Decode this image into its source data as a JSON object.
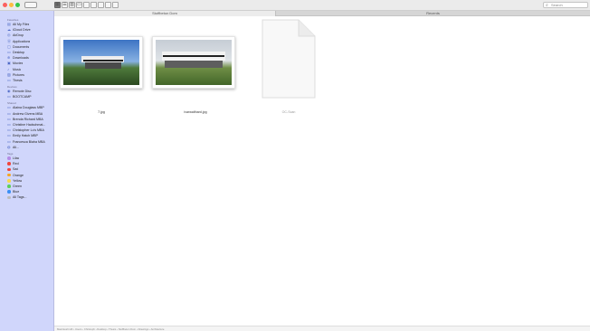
{
  "toolbar": {
    "search_placeholder": "Search",
    "search_glyph": "⌕",
    "view_buttons": [
      "▦",
      "☰",
      "▥",
      "▭"
    ]
  },
  "tabs": [
    {
      "label": "Stoffbeton Dom",
      "active": true
    },
    {
      "label": "Recents",
      "active": false
    }
  ],
  "sidebar": {
    "sections": [
      {
        "heading": "Favorites",
        "items": [
          {
            "label": "All My Files",
            "icon": "all-files-icon",
            "glyph": "▤"
          },
          {
            "label": "iCloud Drive",
            "icon": "cloud-icon",
            "glyph": "☁"
          },
          {
            "label": "AirDrop",
            "icon": "airdrop-icon",
            "glyph": "◎"
          },
          {
            "label": "Applications",
            "icon": "applications-icon",
            "glyph": "Ⓐ"
          },
          {
            "label": "Documents",
            "icon": "documents-icon",
            "glyph": "▢"
          },
          {
            "label": "Desktop",
            "icon": "desktop-icon",
            "glyph": "▭"
          },
          {
            "label": "Downloads",
            "icon": "downloads-icon",
            "glyph": "⊕"
          },
          {
            "label": "Movies",
            "icon": "movies-icon",
            "glyph": "▣"
          },
          {
            "label": "Music",
            "icon": "music-icon",
            "glyph": "♪"
          },
          {
            "label": "Pictures",
            "icon": "pictures-icon",
            "glyph": "▨"
          },
          {
            "label": "Thesis",
            "icon": "folder-icon",
            "glyph": "▭"
          }
        ]
      },
      {
        "heading": "Devices",
        "items": [
          {
            "label": "Remote Disc",
            "icon": "remote-disc-icon",
            "glyph": "◉"
          },
          {
            "label": "BOOTCAMP",
            "icon": "drive-icon",
            "glyph": "▭"
          }
        ]
      },
      {
        "heading": "Shared",
        "items": [
          {
            "label": "Alaina Douglass MBP",
            "icon": "computer-icon",
            "glyph": "▭"
          },
          {
            "label": "Andrew Givens MBA",
            "icon": "computer-icon",
            "glyph": "▭"
          },
          {
            "label": "Brenda Richard MBA",
            "icon": "computer-icon",
            "glyph": "▭"
          },
          {
            "label": "Christine Hadschmat...",
            "icon": "computer-icon",
            "glyph": "▭"
          },
          {
            "label": "Christopher Lo's MBA",
            "icon": "computer-icon",
            "glyph": "▭"
          },
          {
            "label": "Emily Hatch MBP",
            "icon": "computer-icon",
            "glyph": "▭"
          },
          {
            "label": "Francesca Blaha MBA",
            "icon": "computer-icon",
            "glyph": "▭"
          },
          {
            "label": "All...",
            "icon": "network-icon",
            "glyph": "◍"
          }
        ]
      },
      {
        "heading": "Tags",
        "items": [
          {
            "label": "Lilac",
            "tag_color": "#b48be6"
          },
          {
            "label": "Red",
            "tag_color": "#f0453c"
          },
          {
            "label": "Sad",
            "tag_color": "#f0453c"
          },
          {
            "label": "Orange",
            "tag_color": "#f5a623"
          },
          {
            "label": "Yellow",
            "tag_color": "#f8d84a"
          },
          {
            "label": "Green",
            "tag_color": "#5ccf5a"
          },
          {
            "label": "Blue",
            "tag_color": "#3a8ff5"
          },
          {
            "label": "All Tags...",
            "tag_color": "#bbbbbb"
          }
        ]
      }
    ]
  },
  "files": [
    {
      "name": "7.jpg",
      "kind": "image"
    },
    {
      "name": "ivarwalthard.jpg",
      "kind": "image"
    },
    {
      "name": "OC-Scan",
      "kind": "document"
    }
  ],
  "pathbar": {
    "text": "Macintosh HD › Users › Christoph › Desktop › Thesis › Stoffbeton Dom › Drawings › Architecture"
  }
}
